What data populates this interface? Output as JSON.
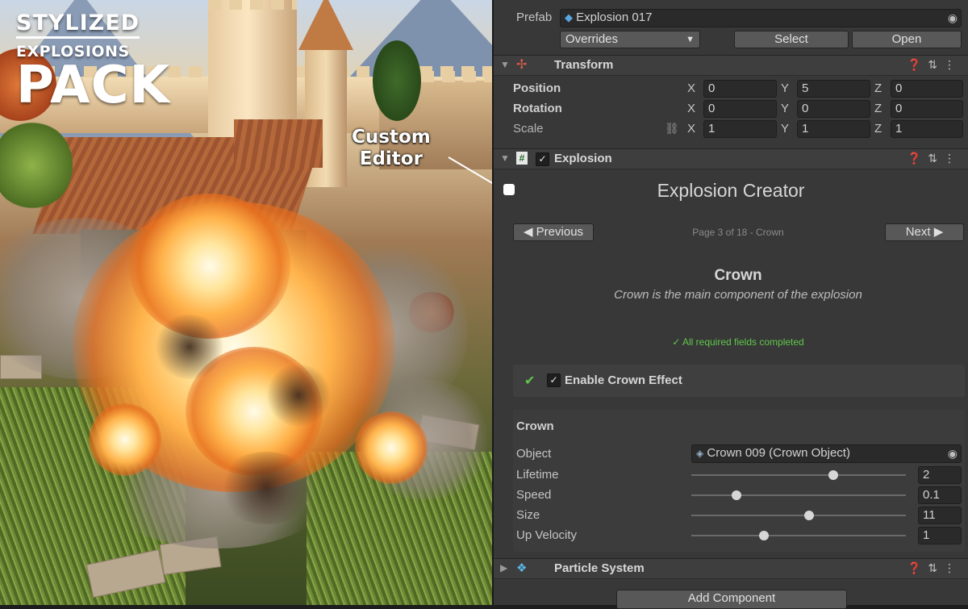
{
  "promo": {
    "line1": "STYLIZED",
    "line2": "EXPLOSIONS",
    "line3": "PACK",
    "callout_line1": "Custom",
    "callout_line2": "Editor"
  },
  "prefab": {
    "label": "Prefab",
    "name": "Explosion 017",
    "overrides_label": "Overrides",
    "select_label": "Select",
    "open_label": "Open"
  },
  "transform": {
    "title": "Transform",
    "rows": [
      {
        "label": "Position",
        "x": "0",
        "y": "5",
        "z": "0"
      },
      {
        "label": "Rotation",
        "x": "0",
        "y": "0",
        "z": "0"
      },
      {
        "label": "Scale",
        "x": "1",
        "y": "1",
        "z": "1"
      }
    ],
    "axis_x": "X",
    "axis_y": "Y",
    "axis_z": "Z"
  },
  "explosion": {
    "title": "Explosion",
    "creator_title": "Explosion Creator",
    "previous_label": "◀ Previous",
    "next_label": "Next ▶",
    "page_info": "Page 3 of 18 - Crown",
    "section_title": "Crown",
    "section_desc": "Crown is the main component of the explosion",
    "status": "✓ All required fields completed",
    "enable_label": "Enable Crown Effect",
    "group_title": "Crown",
    "object_label": "Object",
    "object_value": "Crown 009 (Crown Object)",
    "params": [
      {
        "label": "Lifetime",
        "value": "2",
        "level": 0.66
      },
      {
        "label": "Speed",
        "value": "0.1",
        "level": 0.21
      },
      {
        "label": "Size",
        "value": "11",
        "level": 0.55
      },
      {
        "label": "Up Velocity",
        "value": "1",
        "level": 0.34
      }
    ]
  },
  "particle_system": {
    "title": "Particle System"
  },
  "add_component_label": "Add Component",
  "colors": {
    "accent_green": "#5fc84a",
    "panel_bg": "#383838"
  }
}
